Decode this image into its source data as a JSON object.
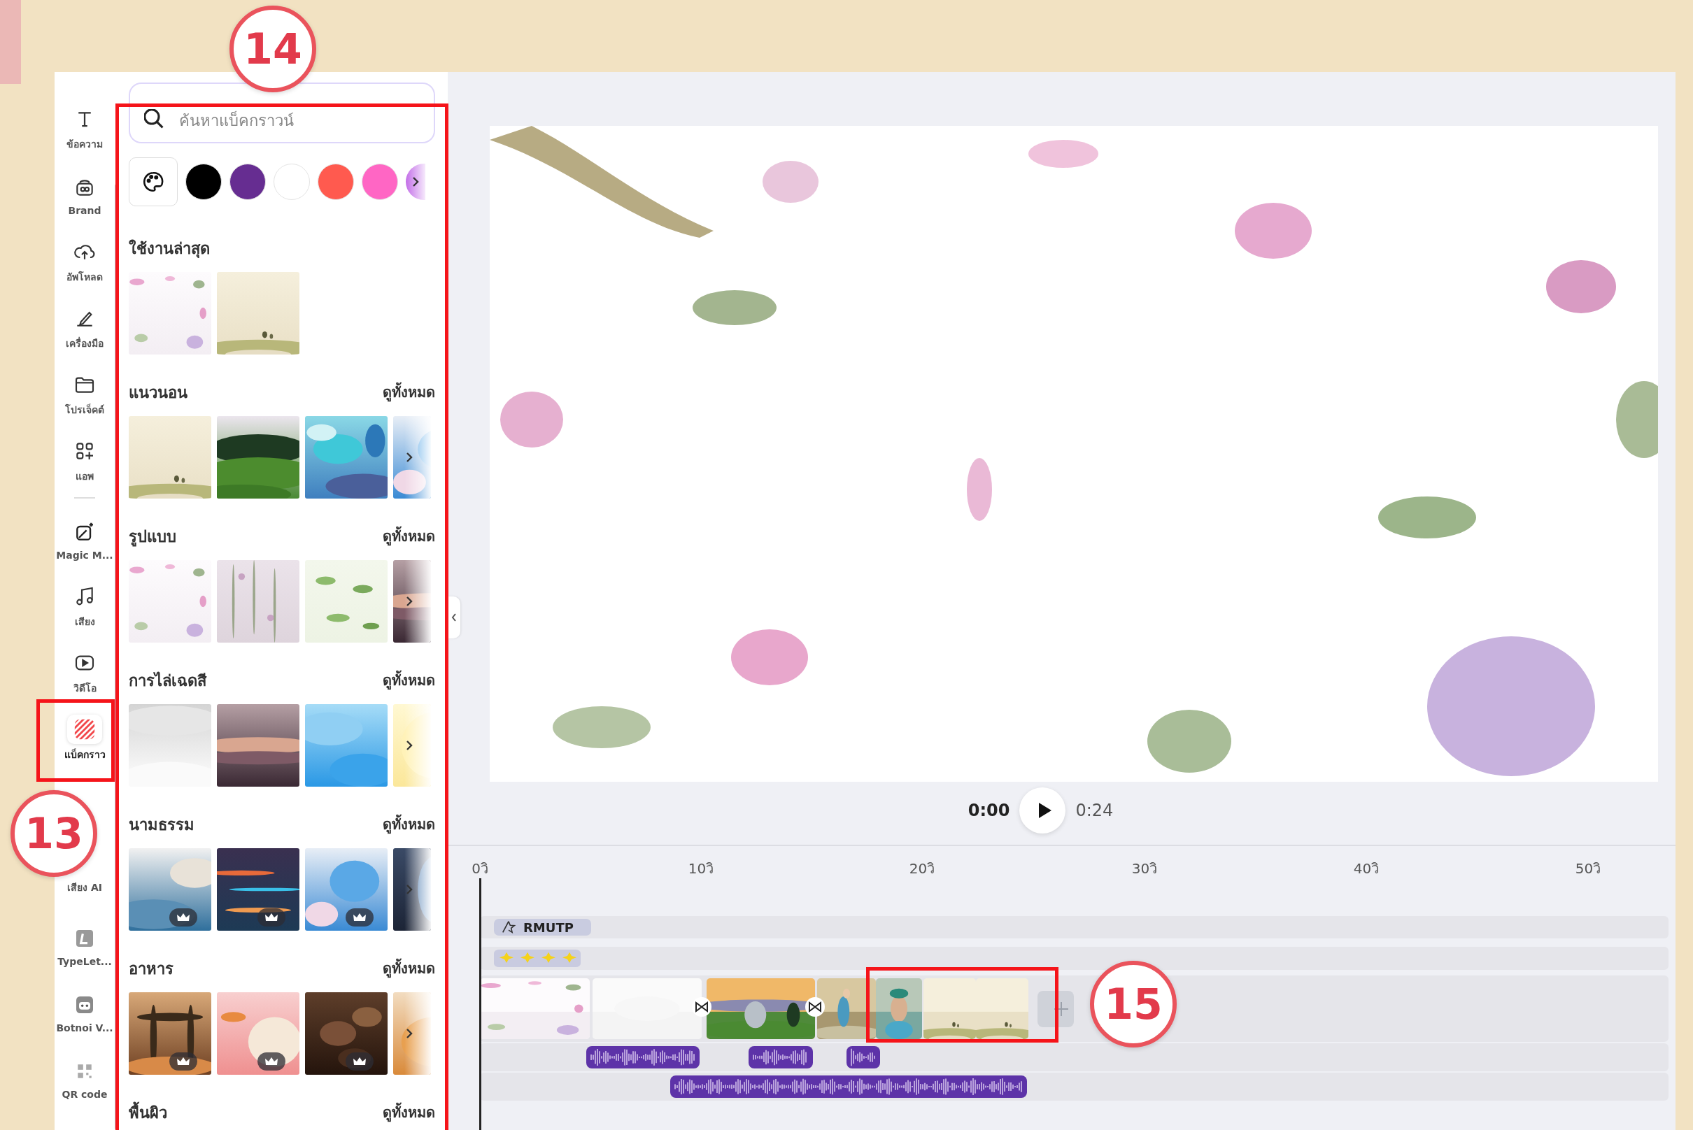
{
  "sidebar": {
    "items": [
      {
        "kind": "text",
        "label": "ข้อความ",
        "selected": false
      },
      {
        "kind": "brand",
        "label": "Brand",
        "selected": false
      },
      {
        "kind": "upload",
        "label": "อัพโหลด",
        "selected": false
      },
      {
        "kind": "tools",
        "label": "เครื่องมือ",
        "selected": false
      },
      {
        "kind": "projects",
        "label": "โปรเจ็คต์",
        "selected": false
      },
      {
        "kind": "apps",
        "label": "แอพ",
        "selected": false
      },
      {
        "kind": "magic",
        "label": "Magic M...",
        "selected": false
      },
      {
        "kind": "audio",
        "label": "เสียง",
        "selected": false
      },
      {
        "kind": "video",
        "label": "วิดีโอ",
        "selected": false
      },
      {
        "kind": "background",
        "label": "แบ็คกราว",
        "selected": true
      },
      {
        "kind": "voice",
        "label": "เสียง AI",
        "selected": false
      },
      {
        "kind": "typelet",
        "label": "TypeLet...",
        "selected": false
      },
      {
        "kind": "botnoi",
        "label": "Botnoi V...",
        "selected": false
      },
      {
        "kind": "qr",
        "label": "QR code",
        "selected": false
      }
    ]
  },
  "panel": {
    "search": {
      "placeholder": "ค้นหาแบ็คกราวน์"
    },
    "swatches": [
      {
        "kind": "palette"
      },
      {
        "kind": "color",
        "color": "#000000"
      },
      {
        "kind": "color",
        "color": "#662d91"
      },
      {
        "kind": "color",
        "color": "#ffffff"
      },
      {
        "kind": "color",
        "color": "#ff5a4f"
      },
      {
        "kind": "color",
        "color": "#ff66c4"
      },
      {
        "kind": "more"
      }
    ],
    "sections": [
      {
        "title": "ใช้งานล่าสุด",
        "thumbs": [
          {
            "kind": "picture",
            "premium": false
          },
          {
            "kind": "picture",
            "premium": false
          }
        ]
      },
      {
        "title": "แนวนอน",
        "see_all": "ดูทั้งหมด",
        "thumbs": [
          {
            "kind": "picture",
            "premium": false
          },
          {
            "kind": "picture",
            "premium": false
          },
          {
            "kind": "picture",
            "premium": false
          },
          {
            "kind": "more"
          }
        ]
      },
      {
        "title": "รูปแบบ",
        "see_all": "ดูทั้งหมด",
        "thumbs": [
          {
            "kind": "picture",
            "premium": false
          },
          {
            "kind": "picture",
            "premium": false
          },
          {
            "kind": "picture",
            "premium": false
          },
          {
            "kind": "more"
          }
        ]
      },
      {
        "title": "การไล่เฉดสี",
        "see_all": "ดูทั้งหมด",
        "thumbs": [
          {
            "kind": "picture",
            "premium": false
          },
          {
            "kind": "picture",
            "premium": false
          },
          {
            "kind": "picture",
            "premium": false
          },
          {
            "kind": "more"
          }
        ]
      },
      {
        "title": "นามธรรม",
        "see_all": "ดูทั้งหมด",
        "thumbs": [
          {
            "kind": "picture",
            "premium": true
          },
          {
            "kind": "picture",
            "premium": true
          },
          {
            "kind": "picture",
            "premium": true
          },
          {
            "kind": "more"
          }
        ]
      },
      {
        "title": "อาหาร",
        "see_all": "ดูทั้งหมด",
        "thumbs": [
          {
            "kind": "picture",
            "premium": true
          },
          {
            "kind": "picture",
            "premium": true
          },
          {
            "kind": "picture",
            "premium": true
          },
          {
            "kind": "more"
          }
        ]
      },
      {
        "title": "พื้นผิว",
        "see_all": "ดูทั้งหมด"
      }
    ]
  },
  "editor": {
    "preview": {
      "kind": "picture"
    },
    "current_time": "0:00",
    "duration": "0:24",
    "ruler": [
      "0วิ",
      "10วิ",
      "20วิ",
      "30วิ",
      "40วิ",
      "50วิ"
    ],
    "tracks": [
      {
        "clips": [
          {
            "kind": "text",
            "label": "RMUTP"
          }
        ]
      },
      {
        "clips": [
          {
            "kind": "sticker"
          }
        ]
      },
      {
        "clips": [
          {
            "kind": "picture"
          },
          {
            "kind": "picture"
          },
          {
            "kind": "transition"
          },
          {
            "kind": "picture"
          },
          {
            "kind": "transition"
          },
          {
            "kind": "picture"
          },
          {
            "kind": "picture"
          },
          {
            "kind": "picture"
          },
          {
            "kind": "picture"
          },
          {
            "kind": "add"
          }
        ]
      },
      {
        "clips": [
          {
            "kind": "audio"
          },
          {
            "kind": "audio"
          },
          {
            "kind": "audio"
          }
        ]
      },
      {
        "clips": [
          {
            "kind": "audio"
          }
        ]
      }
    ]
  },
  "callouts": [
    {
      "label": "14"
    },
    {
      "label": "13"
    },
    {
      "label": "15"
    }
  ]
}
